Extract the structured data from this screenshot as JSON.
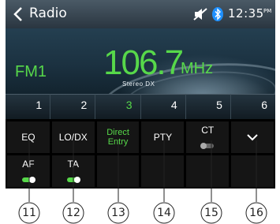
{
  "status_bar": {
    "title": "Radio",
    "time": "12:35",
    "ampm": "PM",
    "icons": [
      "back-chevron-icon",
      "mute-icon",
      "bluetooth-icon"
    ]
  },
  "tuner": {
    "band": "FM1",
    "frequency": "106.7",
    "unit": "MHz",
    "info": "Stereo  DX"
  },
  "presets": [
    {
      "number": "1",
      "active": false
    },
    {
      "number": "2",
      "active": false
    },
    {
      "number": "3",
      "active": true
    },
    {
      "number": "4",
      "active": false
    },
    {
      "number": "5",
      "active": false
    },
    {
      "number": "6",
      "active": false
    }
  ],
  "menu": {
    "row1": [
      {
        "label": "EQ"
      },
      {
        "label": "LO/DX"
      },
      {
        "label_line1": "Direct",
        "label_line2": "Entry"
      },
      {
        "label": "PTY"
      },
      {
        "label": "CT",
        "toggle": "off"
      },
      {
        "icon": "chevron-down-icon"
      }
    ],
    "row2": [
      {
        "label": "AF",
        "toggle": "on"
      },
      {
        "label": "TA",
        "toggle": "on"
      }
    ]
  },
  "callouts": [
    "11",
    "12",
    "13",
    "14",
    "15",
    "16"
  ],
  "colors": {
    "accent_green": "#57d84a",
    "bluetooth": "#1e90ff",
    "menu_bg": "#000000"
  }
}
